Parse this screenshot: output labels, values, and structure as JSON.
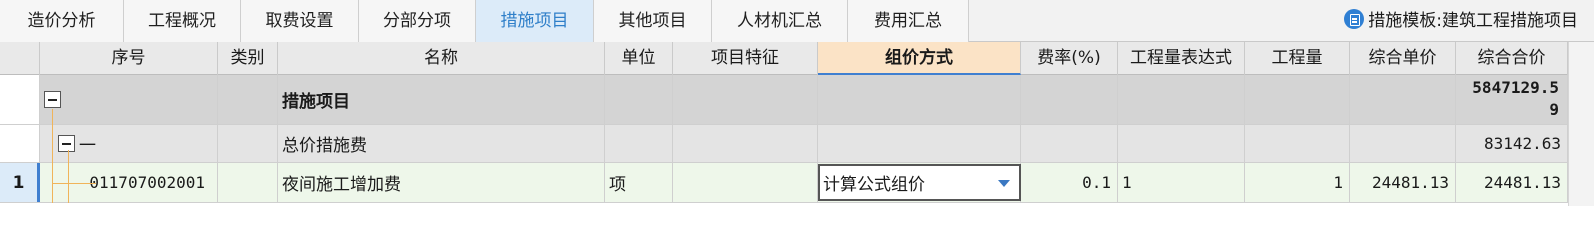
{
  "tabs": [
    {
      "label": "造价分析",
      "active": false
    },
    {
      "label": "工程概况",
      "active": false
    },
    {
      "label": "取费设置",
      "active": false
    },
    {
      "label": "分部分项",
      "active": false
    },
    {
      "label": "措施项目",
      "active": true
    },
    {
      "label": "其他项目",
      "active": false
    },
    {
      "label": "人材机汇总",
      "active": false
    },
    {
      "label": "费用汇总",
      "active": false
    }
  ],
  "template": {
    "label": "措施模板:建筑工程措施项目",
    "icon": "template-doc-icon"
  },
  "columns": [
    "序号",
    "类别",
    "名称",
    "单位",
    "项目特征",
    "组价方式",
    "费率(%)",
    "工程量表达式",
    "工程量",
    "综合单价",
    "综合合价"
  ],
  "selected_column": "组价方式",
  "rows": [
    {
      "row_no": "",
      "code": "",
      "name": "措施项目",
      "total": "5847129.59",
      "total_line1": "5847129.5",
      "total_line2": "9"
    },
    {
      "row_no": "",
      "code": "一",
      "name": "总价措施费",
      "total": "83142.63"
    },
    {
      "row_no": "1",
      "code": "011707002001",
      "name": "夜间施工增加费",
      "unit": "项",
      "method": "计算公式组价",
      "rate": "0.1",
      "expr": "1",
      "qty": "1",
      "unit_price": "24481.13",
      "total": "24481.13"
    }
  ],
  "colors": {
    "active_tab_bg": "#dcebf9",
    "active_tab_text": "#2f7fc9",
    "selected_header_bg": "#fbe3c6",
    "row_highlight": "#eef7ea"
  }
}
